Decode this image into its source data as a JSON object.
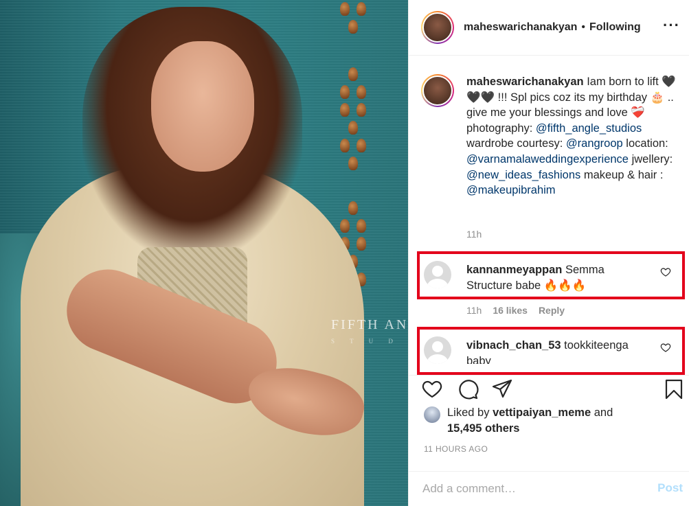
{
  "post": {
    "username": "maheswarichanakyan",
    "follow_separator": "•",
    "follow_status": "Following",
    "more_icon": "more-horizontal-icon"
  },
  "photo": {
    "watermark": "FIFTH ANG",
    "watermark_sub": "S T U D"
  },
  "caption": {
    "username": "maheswarichanakyan",
    "segments": [
      {
        "text": "Iam born to lift 🖤🖤🖤 !!! Spl pics coz its my birthday 🎂 .. give me your blessings and love ❤️‍🩹 photography: "
      },
      {
        "mention": "@fifth_angle_studios"
      },
      {
        "text": " wardrobe courtesy: "
      },
      {
        "mention": "@rangroop"
      },
      {
        "text": " location: "
      },
      {
        "mention": "@varnamalaweddingexperience"
      },
      {
        "text": " jwellery: "
      },
      {
        "mention": "@new_ideas_fashions"
      },
      {
        "text": " makeup & hair : "
      },
      {
        "mention": "@makeupibrahim"
      }
    ],
    "time": "11h"
  },
  "comments": [
    {
      "username": "kannanmeyappan",
      "text": "Semma Structure babe 🔥🔥🔥",
      "time": "11h",
      "likes": "16 likes",
      "reply": "Reply"
    },
    {
      "username": "vibnach_chan_53",
      "text": "tookkiteenga baby"
    }
  ],
  "actions": {
    "like_icon": "heart-icon",
    "comment_icon": "comment-icon",
    "share_icon": "send-icon",
    "save_icon": "bookmark-icon"
  },
  "likes": {
    "prefix": "Liked by",
    "user": "vettipaiyan_meme",
    "and": "and",
    "others": "15,495 others"
  },
  "timestamp": "11 HOURS AGO",
  "add_comment": {
    "placeholder": "Add a comment…",
    "post_label": "Post"
  },
  "colors": {
    "highlight": "#e3001b",
    "mention": "#00376b",
    "post_disabled": "#b2dffc"
  }
}
